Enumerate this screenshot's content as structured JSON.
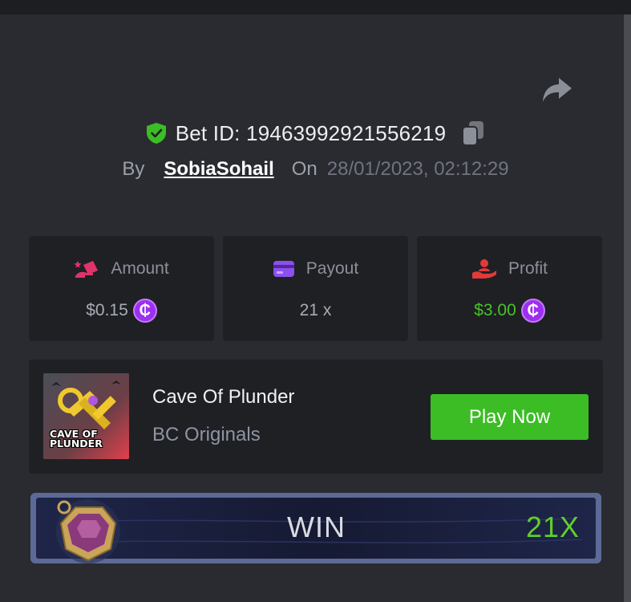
{
  "bet": {
    "label": "Bet ID: 19463992921556219",
    "by_label": "By",
    "username": "SobiaSohail",
    "on_label": "On",
    "datetime": "28/01/2023, 02:12:29"
  },
  "stats": [
    {
      "label": "Amount",
      "value": "$0.15",
      "icon": "cash-hand-icon",
      "color": "#e0336b",
      "value_color": "#a8acb5",
      "coin": true
    },
    {
      "label": "Payout",
      "value": "21 x",
      "icon": "card-icon",
      "color": "#8d4ff0",
      "value_color": "#a8acb5",
      "coin": false
    },
    {
      "label": "Profit",
      "value": "$3.00",
      "icon": "profit-hand-icon",
      "color": "#e23a3a",
      "value_color": "#49c32a",
      "coin": true
    }
  ],
  "coin_symbol": "₵",
  "game": {
    "title": "Cave Of Plunder",
    "subtitle": "BC Originals",
    "play_label": "Play Now",
    "thumb_text": "CAVE OF PLUNDER"
  },
  "win": {
    "label": "WIN",
    "multiplier": "21X"
  },
  "colors": {
    "background": "#2a2b30",
    "card": "#1f2024",
    "accent_green": "#3cbd25",
    "coin": "#9d2ff0"
  }
}
